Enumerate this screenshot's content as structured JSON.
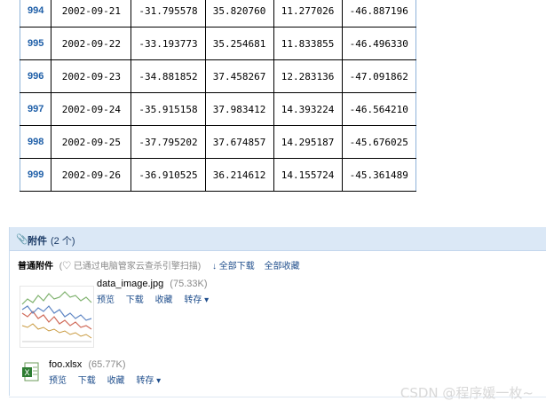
{
  "table": {
    "rows": [
      {
        "idx": "994",
        "date": "2002-09-21",
        "a": "-31.795578",
        "b": "35.820760",
        "c": "11.277026",
        "d": "-46.887196"
      },
      {
        "idx": "995",
        "date": "2002-09-22",
        "a": "-33.193773",
        "b": "35.254681",
        "c": "11.833855",
        "d": "-46.496330"
      },
      {
        "idx": "996",
        "date": "2002-09-23",
        "a": "-34.881852",
        "b": "37.458267",
        "c": "12.283136",
        "d": "-47.091862"
      },
      {
        "idx": "997",
        "date": "2002-09-24",
        "a": "-35.915158",
        "b": "37.983412",
        "c": "14.393224",
        "d": "-46.564210"
      },
      {
        "idx": "998",
        "date": "2002-09-25",
        "a": "-37.795202",
        "b": "37.674857",
        "c": "14.295187",
        "d": "-45.676025"
      },
      {
        "idx": "999",
        "date": "2002-09-26",
        "a": "-36.910525",
        "b": "36.214612",
        "c": "14.155724",
        "d": "-45.361489"
      }
    ]
  },
  "attachments": {
    "title": "附件",
    "count": "(2 个)",
    "normal_label": "普通附件",
    "scan_note": "(♡ 已通过电脑管家云查杀引擎扫描)",
    "download_all": "↓ 全部下载",
    "collect_all": "全部收藏",
    "files": [
      {
        "name": "data_image.jpg",
        "size": "(75.33K)",
        "actions": [
          "预览",
          "下载",
          "收藏",
          "转存 ▾"
        ]
      },
      {
        "name": "foo.xlsx",
        "size": "(65.77K)",
        "actions": [
          "预览",
          "下载",
          "收藏",
          "转存 ▾"
        ]
      }
    ]
  },
  "watermark": "CSDN @程序媛一枚~"
}
